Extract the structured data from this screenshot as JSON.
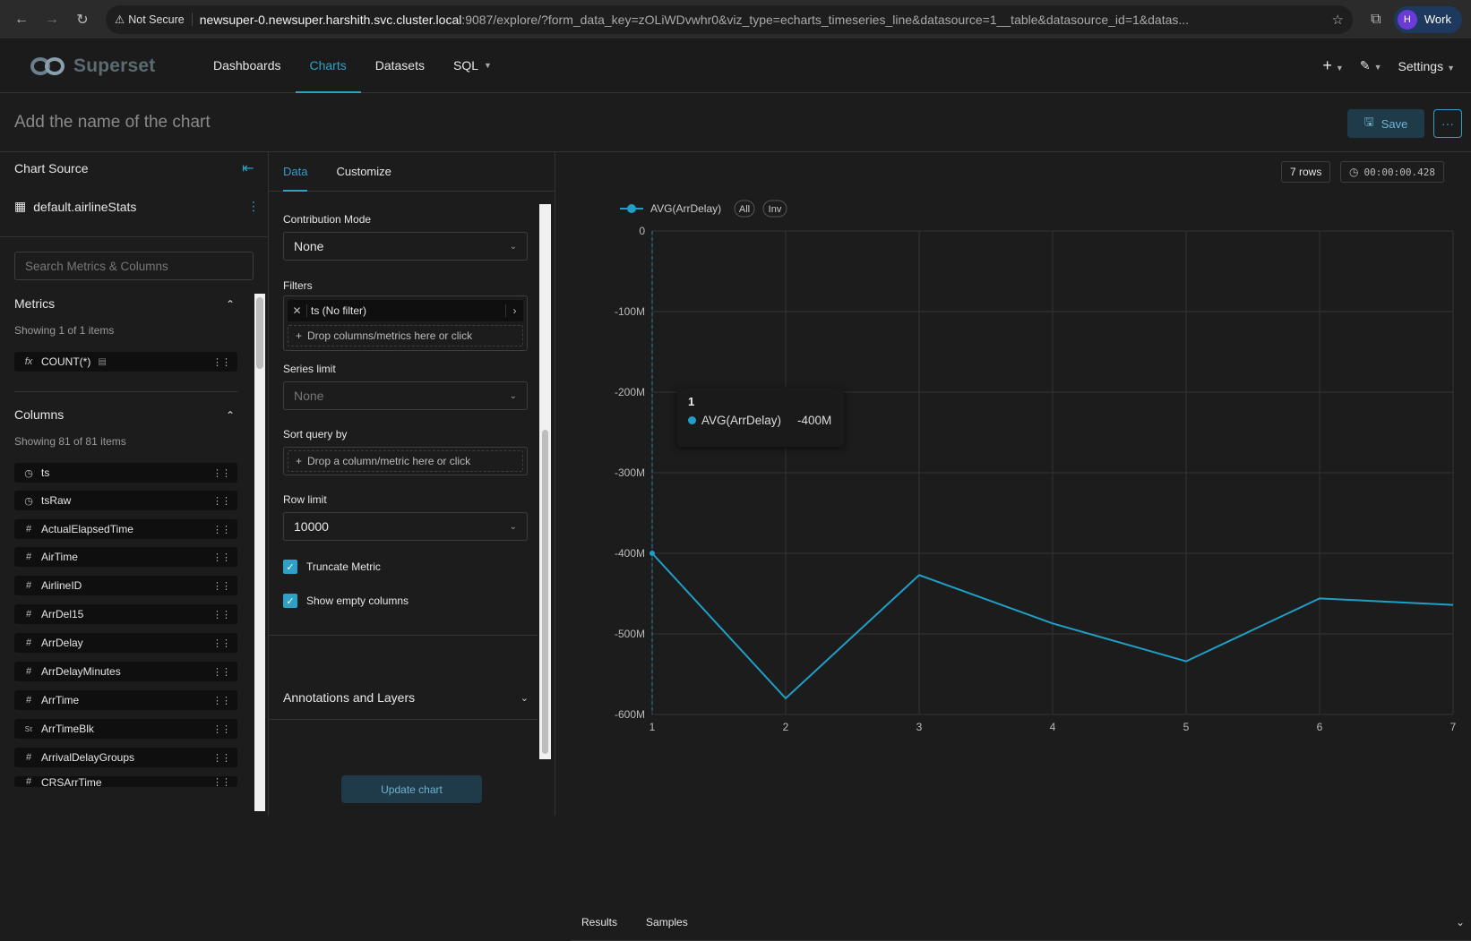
{
  "browser": {
    "security_label": "Not Secure",
    "url_host": "newsuper-0.newsuper.harshith.svc.cluster.local",
    "url_rest": ":9087/explore/?form_data_key=zOLiWDvwhr0&viz_type=echarts_timeseries_line&datasource=1__table&datasource_id=1&datas...",
    "profile_initial": "H",
    "profile_label": "Work"
  },
  "nav": {
    "brand": "Superset",
    "items": [
      {
        "label": "Dashboards"
      },
      {
        "label": "Charts"
      },
      {
        "label": "Datasets"
      },
      {
        "label": "SQL"
      }
    ],
    "plus": "+",
    "settings": "Settings"
  },
  "header": {
    "title_placeholder": "Add the name of the chart",
    "save_label": "Save",
    "more_label": "···"
  },
  "left": {
    "chart_source": "Chart Source",
    "dataset": "default.airlineStats",
    "search_placeholder": "Search Metrics & Columns",
    "metrics_title": "Metrics",
    "metrics_count": "Showing 1 of 1 items",
    "metrics": [
      {
        "label": "COUNT(*)",
        "icon": "fx"
      }
    ],
    "columns_title": "Columns",
    "columns_count": "Showing 81 of 81 items",
    "columns": [
      {
        "label": "ts",
        "icon": "clock"
      },
      {
        "label": "tsRaw",
        "icon": "clock"
      },
      {
        "label": "ActualElapsedTime",
        "icon": "#"
      },
      {
        "label": "AirTime",
        "icon": "#"
      },
      {
        "label": "AirlineID",
        "icon": "#"
      },
      {
        "label": "ArrDel15",
        "icon": "#"
      },
      {
        "label": "ArrDelay",
        "icon": "#"
      },
      {
        "label": "ArrDelayMinutes",
        "icon": "#"
      },
      {
        "label": "ArrTime",
        "icon": "#"
      },
      {
        "label": "ArrTimeBlk",
        "icon": "abc"
      },
      {
        "label": "ArrivalDelayGroups",
        "icon": "#"
      },
      {
        "label": "CRSArrTime",
        "icon": "#"
      }
    ]
  },
  "mid": {
    "tab_data": "Data",
    "tab_customize": "Customize",
    "contribution_label": "Contribution Mode",
    "contribution_value": "None",
    "filters_label": "Filters",
    "filter_pill": "ts (No filter)",
    "filters_drop": "Drop columns/metrics here or click",
    "series_limit_label": "Series limit",
    "series_limit_value": "None",
    "sort_label": "Sort query by",
    "sort_drop": "Drop a column/metric here or click",
    "row_limit_label": "Row limit",
    "row_limit_value": "10000",
    "truncate_label": "Truncate Metric",
    "show_empty_label": "Show empty columns",
    "annotations_label": "Annotations and Layers",
    "update_label": "Update chart"
  },
  "chart_meta": {
    "rows": "7 rows",
    "time": "00:00:00.428",
    "legend_all": "All",
    "legend_inv": "Inv",
    "tooltip_title": "1",
    "tooltip_series": "AVG(ArrDelay)",
    "tooltip_value": "-400M",
    "line_color": "#1f9fc6"
  },
  "chart_data": {
    "type": "line",
    "series": [
      {
        "name": "AVG(ArrDelay)",
        "x": [
          1,
          2,
          3,
          4,
          5,
          6,
          7
        ],
        "y": [
          -400,
          -580,
          -427,
          -487,
          -534,
          -456,
          -464
        ]
      }
    ],
    "y_unit": "M",
    "yticks": [
      "0",
      "-100M",
      "-200M",
      "-300M",
      "-400M",
      "-500M",
      "-600M"
    ],
    "xticks": [
      "1",
      "2",
      "3",
      "4",
      "5",
      "6",
      "7"
    ],
    "ylim": [
      -600,
      0
    ],
    "xlim": [
      1,
      7
    ],
    "grid": true,
    "legend": "top-left"
  },
  "bottom": {
    "results": "Results",
    "samples": "Samples"
  }
}
